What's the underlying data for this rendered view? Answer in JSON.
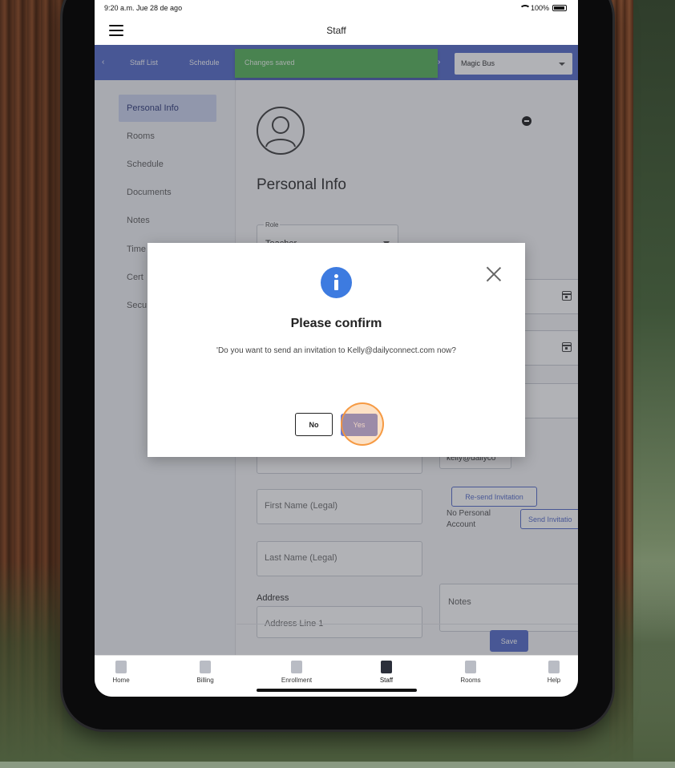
{
  "status_bar": {
    "time": "9:20 a.m.  Jue 28 de ago",
    "battery": "100%"
  },
  "app_bar": {
    "title": "Staff"
  },
  "tabs": {
    "items": [
      "Staff List",
      "Schedule"
    ]
  },
  "toast": {
    "message": "Changes saved"
  },
  "program_select": {
    "value": "Magic Bus"
  },
  "sidebar": {
    "items": [
      {
        "label": "Personal Info",
        "active": true
      },
      {
        "label": "Rooms"
      },
      {
        "label": "Schedule"
      },
      {
        "label": "Documents"
      },
      {
        "label": "Notes"
      },
      {
        "label": "Time"
      },
      {
        "label": "Cert"
      },
      {
        "label": "Secu"
      }
    ]
  },
  "content": {
    "section_title": "Personal Info",
    "role": {
      "label": "Role",
      "value": "Teacher"
    },
    "email_value": "kelly@dailyco",
    "first_name_placeholder": "First Name (Legal)",
    "last_name_placeholder": "Last Name (Legal)",
    "address_label": "Address",
    "address_line1_placeholder": "Address Line 1",
    "notes_placeholder": "Notes",
    "resend_button": "Re-send Invitation",
    "no_account_text": "No Personal Account",
    "send_button": "Send Invitatio",
    "save_button": "Save"
  },
  "bottom_nav": {
    "items": [
      {
        "label": "Home"
      },
      {
        "label": "Billing"
      },
      {
        "label": "Enrollment"
      },
      {
        "label": "Staff",
        "active": true
      },
      {
        "label": "Rooms"
      },
      {
        "label": "Help"
      }
    ]
  },
  "dialog": {
    "title": "Please confirm",
    "message": "'Do you want to send an invitation to Kelly@dailyconnect.com now?",
    "no_button": "No",
    "yes_button": "Yes"
  },
  "colors": {
    "accent": "#4b63c7",
    "toast": "#4caf50",
    "info_icon": "#3d7be0",
    "click_highlight": "#f59a3c"
  }
}
